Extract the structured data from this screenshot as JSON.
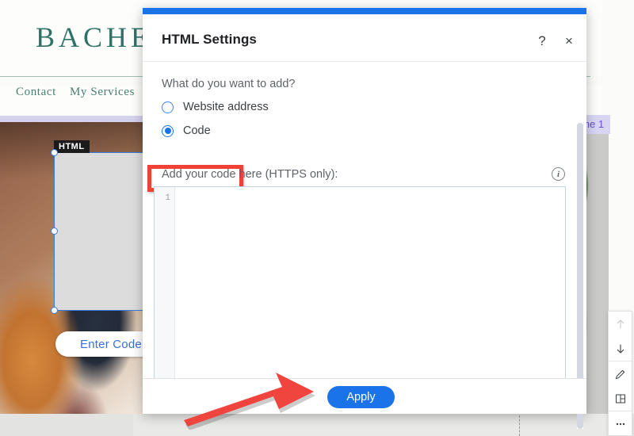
{
  "background": {
    "site_logo": "BACHE",
    "nav_items": [
      ":",
      "Contact",
      "My Services"
    ],
    "widget_badge": "HTML",
    "enter_code_button": "Enter Code",
    "welcome_tab": "ome 1",
    "toolbar": {
      "move_up": "move-up",
      "move_down": "move-down",
      "edit": "edit",
      "layout": "layout",
      "more": "more-options"
    }
  },
  "dialog": {
    "title": "HTML Settings",
    "help_label": "?",
    "close_label": "×",
    "question": "What do you want to add?",
    "options": [
      {
        "label": "Website address",
        "selected": false
      },
      {
        "label": "Code",
        "selected": true
      }
    ],
    "code_label": "Add your code here (HTTPS only):",
    "info_label": "i",
    "line_number": "1",
    "code_value": "",
    "code_placeholder": "",
    "apply_label": "Apply"
  },
  "colors": {
    "accent_blue": "#1a73e8",
    "highlight_red": "#ef4136",
    "arrow_red": "#f0453f",
    "site_green": "#2e7265",
    "welcome_purple": "#d8d5f2"
  }
}
